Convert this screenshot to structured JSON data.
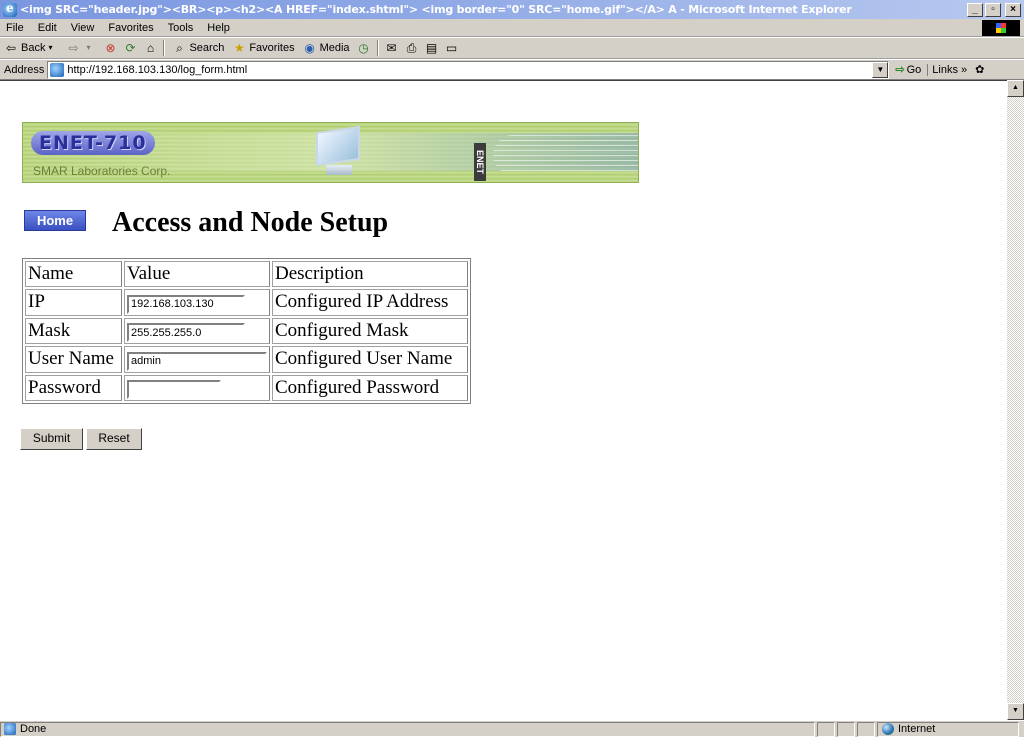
{
  "window": {
    "title": "<img SRC=\"header.jpg\"><BR><p><h2><A HREF=\"index.shtml\"> <img border=\"0\" SRC=\"home.gif\"></A>  A - Microsoft Internet Explorer",
    "minimize": "_",
    "maximize": "▫",
    "close": "×"
  },
  "menu": [
    "File",
    "Edit",
    "View",
    "Favorites",
    "Tools",
    "Help"
  ],
  "toolbar": {
    "back": "Back",
    "search": "Search",
    "favorites": "Favorites",
    "media": "Media"
  },
  "address": {
    "label": "Address",
    "url": "http://192.168.103.130/log_form.html",
    "go": "Go",
    "links": "Links"
  },
  "banner": {
    "brand": "ENET-710",
    "company": "SMAR Laboratories Corp.",
    "vertical": "ENET"
  },
  "page": {
    "home_label": "Home",
    "title": "Access and Node Setup"
  },
  "table": {
    "headers": [
      "Name",
      "Value",
      "Description"
    ],
    "rows": [
      {
        "name": "IP",
        "value": "192.168.103.130",
        "description": "Configured IP Address"
      },
      {
        "name": "Mask",
        "value": "255.255.255.0",
        "description": "Configured Mask"
      },
      {
        "name": "User Name",
        "value": "admin",
        "description": "Configured User Name"
      },
      {
        "name": "Password",
        "value": "",
        "description": "Configured Password"
      }
    ]
  },
  "buttons": {
    "submit": "Submit",
    "reset": "Reset"
  },
  "status": {
    "text": "Done",
    "zone": "Internet"
  }
}
